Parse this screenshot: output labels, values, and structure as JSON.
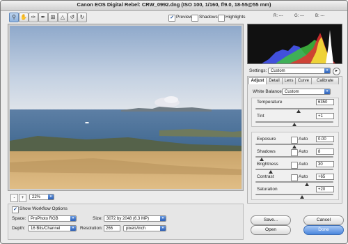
{
  "window": {
    "title": "Canon EOS Digital Rebel:  CRW_0992.dng  (ISO 100, 1/160, f/9.0, 18-55@55 mm)"
  },
  "toolbar": {
    "tools": [
      "zoom-tool",
      "hand-tool",
      "white-balance-tool",
      "color-sampler-tool",
      "crop-tool",
      "straighten-tool",
      "rotate-left",
      "rotate-right"
    ],
    "preview_label": "Preview",
    "preview_checked": true,
    "shadows_label": "Shadows",
    "shadows_checked": false,
    "highlights_label": "Highlights",
    "highlights_checked": false,
    "rgb_readout": [
      "R:  ---",
      "G:  ---",
      "B:  ---"
    ]
  },
  "zoom": {
    "minus": "-",
    "plus": "+",
    "level": "22%"
  },
  "workflow": {
    "show_label": "Show Workflow Options",
    "show_checked": true,
    "space_label": "Space:",
    "space_value": "ProPhoto RGB",
    "depth_label": "Depth:",
    "depth_value": "16 Bits/Channel",
    "size_label": "Size:",
    "size_value": "3072 by 2048  (6.3 MP)",
    "resolution_label": "Resolution:",
    "resolution_value": "266",
    "resolution_unit": "pixels/inch"
  },
  "settings": {
    "label": "Settings:",
    "value": "Custom"
  },
  "tabs": [
    "Adjust",
    "Detail",
    "Lens",
    "Curve",
    "Calibrate"
  ],
  "adjust": {
    "white_balance_label": "White Balance:",
    "white_balance_value": "Custom",
    "temperature": {
      "label": "Temperature",
      "value": "6350",
      "level": 0.55
    },
    "tint": {
      "label": "Tint",
      "value": "+1",
      "level": 0.5
    },
    "auto_label": "Auto",
    "exposure": {
      "label": "Exposure",
      "value": "0.00",
      "level": 0.5
    },
    "shadows": {
      "label": "Shadows",
      "value": "8",
      "level": 0.08
    },
    "brightness": {
      "label": "Brightness",
      "value": "30",
      "level": 0.2
    },
    "contrast": {
      "label": "Contrast",
      "value": "+65",
      "level": 0.66
    },
    "saturation": {
      "label": "Saturation",
      "value": "+20",
      "level": 0.6
    }
  },
  "buttons": {
    "save": "Save...",
    "cancel": "Cancel",
    "open": "Open",
    "done": "Done"
  }
}
